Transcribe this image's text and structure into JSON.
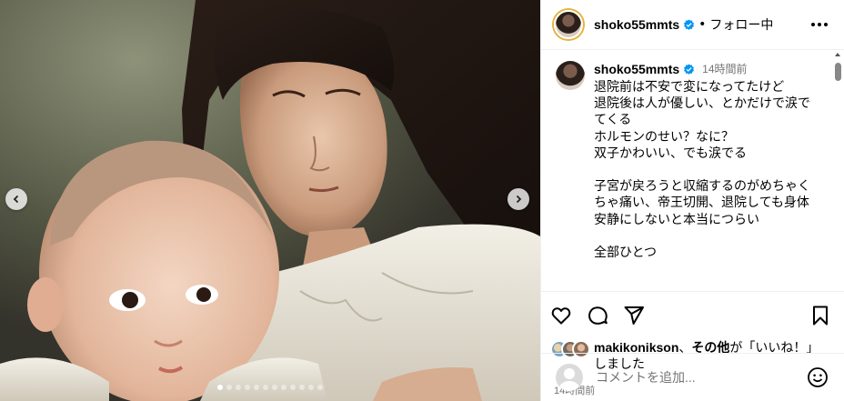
{
  "post": {
    "username": "shoko55mmts",
    "follow_status": "フォロー中",
    "separator": "•",
    "caption_time": "14時間前",
    "caption_text": "退院前は不安で変になってたけど\n退院後は人が優しい、とかだけで涙で\nてくる\nホルモンのせい？なに？\n双子かわいい、でも涙でる\n\n子宮が戻ろうと収縮するのがめちゃく\nちゃ痛い、帝王切開、退院しても身体\n安静にしないと本当につらい\n\n全部ひとつ",
    "likes_user": "makikonikson",
    "likes_sep": "、",
    "likes_others": "その他",
    "likes_middle": "が「いいね！」",
    "likes_end": "しました",
    "timestamp": "14時間前",
    "comment_placeholder": "コメントを追加..."
  },
  "carousel": {
    "slide_count": 12,
    "active_index": 0
  },
  "icons": {
    "verified": "verified-badge-icon",
    "more": "more-options-icon",
    "like": "heart-icon",
    "comment": "comment-icon",
    "share": "share-icon",
    "save": "bookmark-icon",
    "emoji": "emoji-icon",
    "prev": "chevron-left-icon",
    "next": "chevron-right-icon"
  },
  "colors": {
    "verified_blue": "#0095f6",
    "ring": "#e6b23a",
    "secondary_text": "#737373"
  }
}
